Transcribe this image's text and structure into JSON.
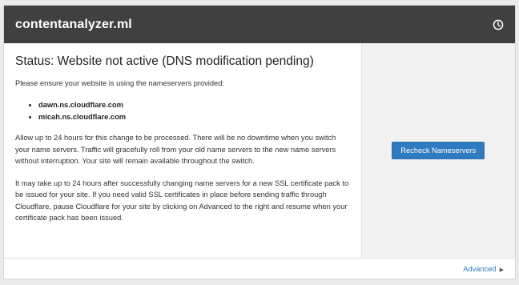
{
  "header": {
    "title": "contentanalyzer.ml",
    "icon": "clock-icon"
  },
  "main": {
    "status_title": "Status: Website not active (DNS modification pending)",
    "intro": "Please ensure your website is using the nameservers provided:",
    "nameservers": [
      "dawn.ns.cloudflare.com",
      "micah.ns.cloudflare.com"
    ],
    "paragraph1": "Allow up to 24 hours for this change to be processed. There will be no downtime when you switch your name servers. Traffic will gracefully roll from your old name servers to the new name servers without interruption. Your site will remain available throughout the switch.",
    "paragraph2": "It may take up to 24 hours after successfully changing name servers for a new SSL certificate pack to be issued for your site. If you need valid SSL certificates in place before sending traffic through Cloudflare, pause Cloudflare for your site by clicking on Advanced to the right and resume when your certificate pack has been issued."
  },
  "side": {
    "recheck_label": "Recheck Nameservers"
  },
  "footer": {
    "advanced_label": "Advanced",
    "caret_icon": "caret-right-icon"
  },
  "colors": {
    "header_bg": "#404040",
    "button_bg": "#2f7bbf",
    "link": "#2f7bbf",
    "side_bg": "#f2f2f2"
  }
}
